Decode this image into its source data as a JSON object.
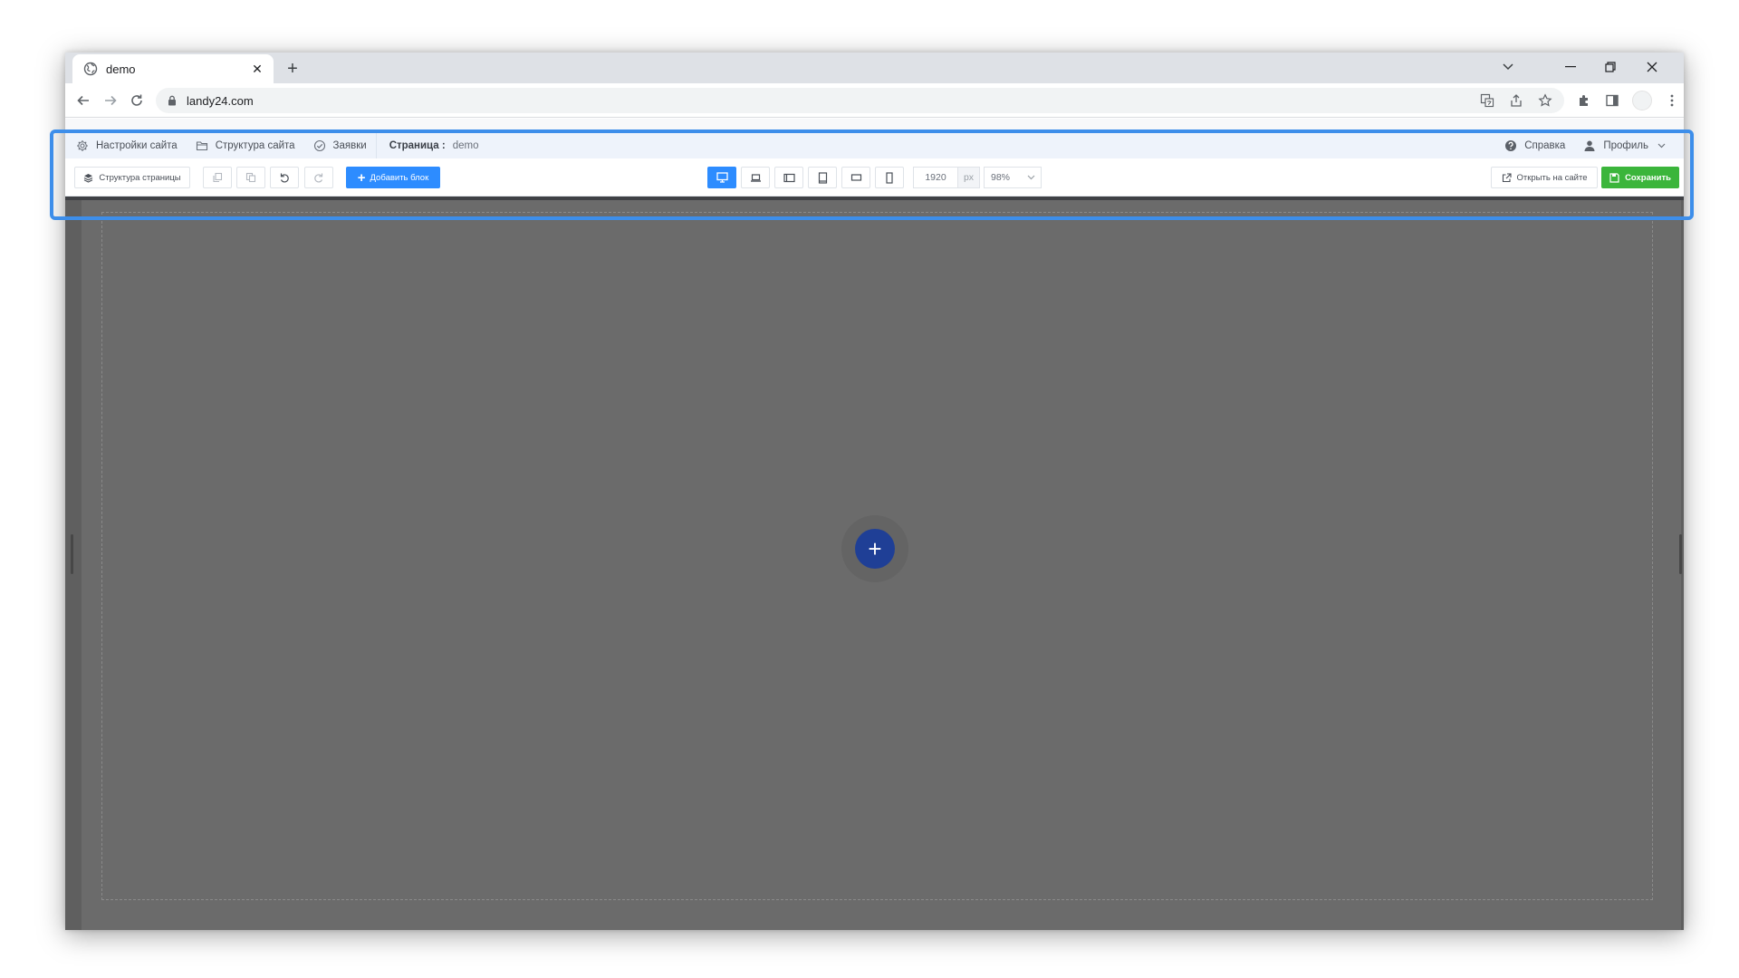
{
  "browser": {
    "tab_title": "demo",
    "url": "landy24.com"
  },
  "editor": {
    "menu": {
      "site_settings": "Настройки сайта",
      "site_structure": "Структура сайта",
      "requests": "Заявки",
      "page_label": "Страница :",
      "page_name": "demo",
      "help": "Справка",
      "profile": "Профиль"
    },
    "toolbar": {
      "page_structure": "Структура страницы",
      "add_block": "Добавить блок",
      "width_value": "1920",
      "width_unit": "px",
      "zoom": "98%",
      "open_on_site": "Открыть на сайте",
      "save": "Сохранить",
      "active_device": "desktop"
    }
  },
  "colors": {
    "primary_blue": "#2d8cff",
    "save_green": "#3bb53b",
    "canvas_gray": "#6b6b6b",
    "add_button": "#1f3f96",
    "highlight": "#3d8eea"
  }
}
